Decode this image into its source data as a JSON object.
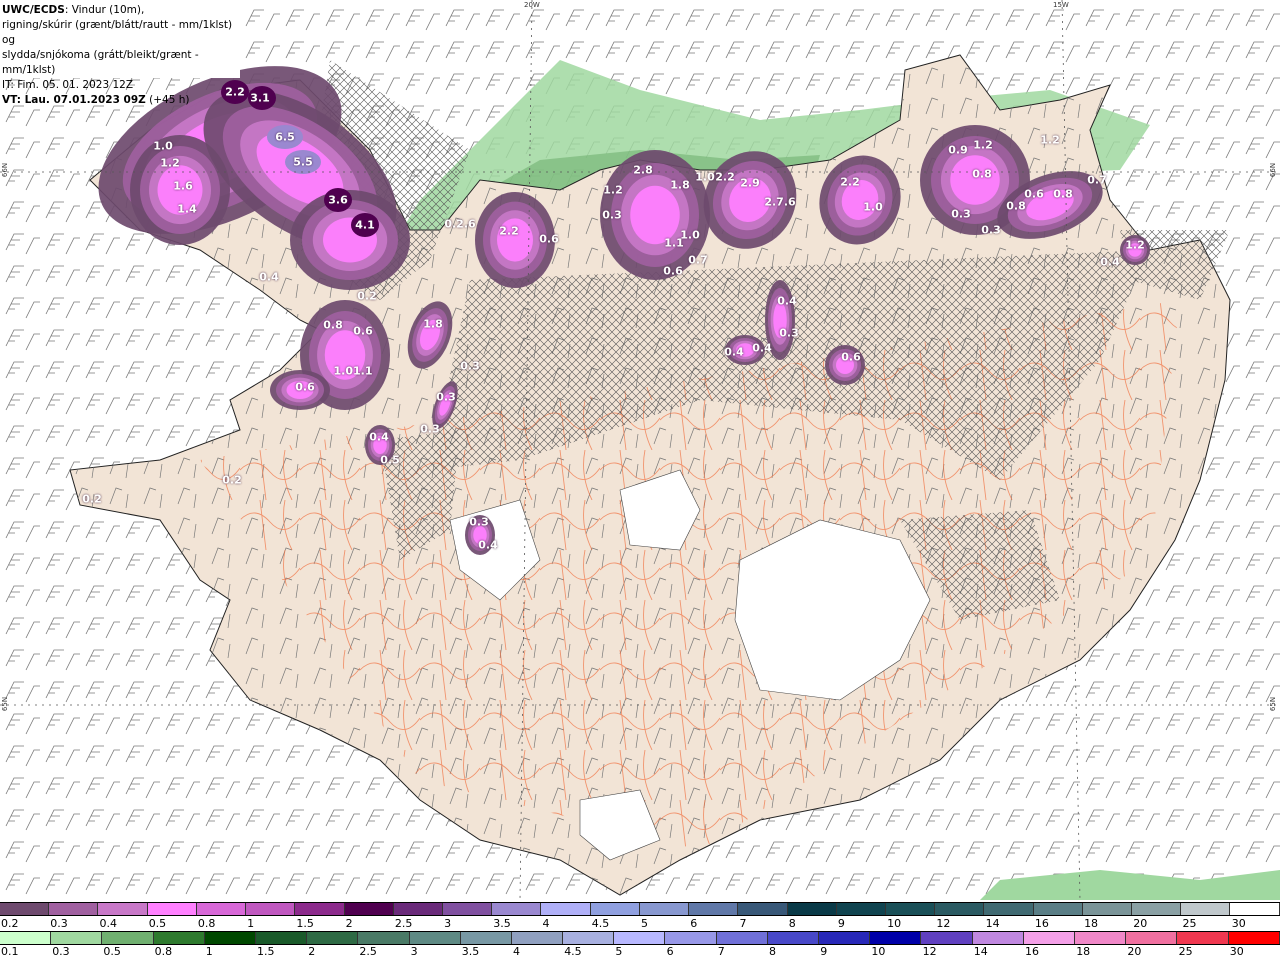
{
  "header": {
    "source": "UWC/ECDS",
    "line1_rest": ": Vindur (10m),",
    "line2": "rigning/skúrir (grænt/blátt/rautt - mm/1klst) og",
    "line3": "slydda/snjókoma (grátt/bleikt/grænt - mm/1klst)",
    "it": "IT: Fim. 05. 01. 2023 12Z",
    "vt_bold": "VT: Lau. 07.01.2023 09Z",
    "vt_lead": "(+45 h)"
  },
  "grid_labels": {
    "lon_20w": "20W",
    "lon_15w": "15W",
    "lat_66n_left": "66N",
    "lat_66n_right": "66N",
    "lat_65n_left": "65N",
    "lat_65n_right": "65N"
  },
  "map": {
    "land_color": "#f2e4d6",
    "sea_color": "#ffffff",
    "road_color": "#f07040",
    "values": [
      "2.2",
      "3.1",
      "6.5",
      "5.5",
      "3.6",
      "4.1",
      "1.0",
      "1.2",
      "1.6",
      "1.4",
      "0.4",
      "0.2",
      "0.2.6",
      "2.2",
      "0.6",
      "1.2",
      "2.8",
      "1.8",
      "0.3",
      "1.1",
      "1.0",
      "0.6",
      "0.7",
      "1.0",
      "2.2",
      "2.9",
      "2.7.6",
      "2.2",
      "1.0",
      "0.9",
      "1.2",
      "0.8",
      "0.3",
      "0.3",
      "0.8",
      "0.6",
      "0.8",
      "0.7",
      "1.2",
      "0.4",
      "1.8",
      "0.8",
      "0.6",
      "1.01.1",
      "0.6",
      "0.3",
      "0.3",
      "0.3",
      "0.4",
      "0.5",
      "0.4",
      "0.3",
      "0.4",
      "0.4",
      "0.6",
      "0.3",
      "0.4",
      "0.2",
      "0.2",
      "1.2"
    ]
  },
  "legend_snow": {
    "labels": [
      "0.2",
      "0.3",
      "0.4",
      "0.5",
      "0.8",
      "1",
      "1.5",
      "2",
      "2.5",
      "3",
      "3.5",
      "4",
      "4.5",
      "5",
      "6",
      "7",
      "8",
      "9",
      "10",
      "12",
      "14",
      "16",
      "18",
      "20",
      "25",
      "30"
    ],
    "colors": [
      "#6e4a6e",
      "#a060a0",
      "#c878c8",
      "#ff80ff",
      "#d868d8",
      "#c058c0",
      "#8c2a8c",
      "#500050",
      "#6a2a7a",
      "#8050a0",
      "#9a88d0",
      "#b0b0f8",
      "#90a0e0",
      "#8898d0",
      "#6078a8",
      "#385878",
      "#0a3a48",
      "#104450",
      "#1a5058",
      "#2a5a62",
      "#406a72",
      "#5a7e86",
      "#7a9498",
      "#8aa0a4",
      "#c0c8cc",
      "#ffffff"
    ]
  },
  "legend_rain": {
    "labels": [
      "0.1",
      "0.3",
      "0.5",
      "0.8",
      "1",
      "1.5",
      "2",
      "2.5",
      "3",
      "3.5",
      "4",
      "4.5",
      "5",
      "6",
      "7",
      "8",
      "9",
      "10",
      "12",
      "14",
      "16",
      "18",
      "20",
      "25",
      "30"
    ],
    "colors": [
      "#ccffcc",
      "#a0d8a0",
      "#70b070",
      "#2e7a2e",
      "#004800",
      "#1a5a2a",
      "#2e6a44",
      "#4a7a66",
      "#5e8a84",
      "#7898a4",
      "#90a0c0",
      "#a8b0e0",
      "#b8b8ff",
      "#9898e8",
      "#7070d8",
      "#4848c8",
      "#2828b8",
      "#0000a8",
      "#6040c0",
      "#c088e0",
      "#f4a0e8",
      "#f088c8",
      "#f070a0",
      "#f03850",
      "#ff0000"
    ]
  }
}
